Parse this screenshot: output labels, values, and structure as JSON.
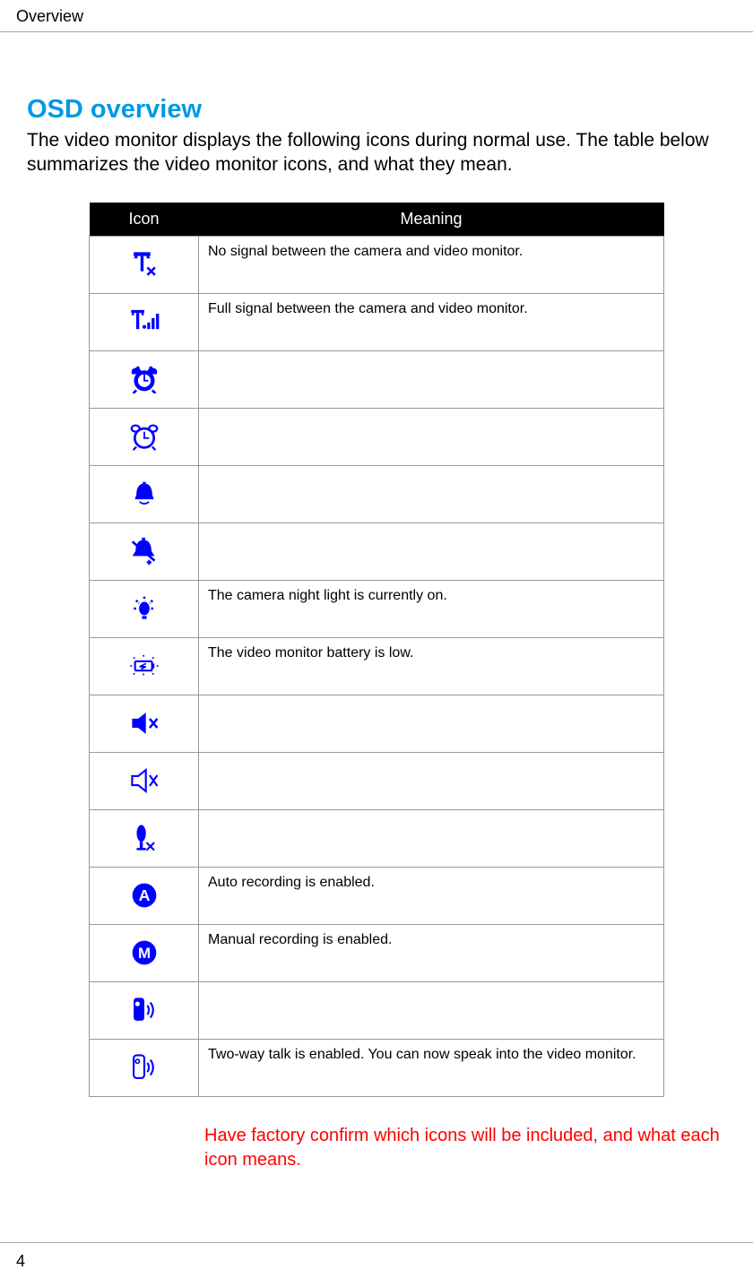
{
  "header": {
    "section": "Overview"
  },
  "title": "OSD overview",
  "intro": "The video monitor displays the following icons during normal use. The table below summarizes the video monitor icons, and what they mean.",
  "table": {
    "col_icon": "Icon",
    "col_meaning": "Meaning",
    "rows": [
      {
        "icon": "no-signal-icon",
        "meaning": "No signal between the camera and video monitor."
      },
      {
        "icon": "full-signal-icon",
        "meaning": "Full signal between the camera and video monitor."
      },
      {
        "icon": "alarm-solid-icon",
        "meaning": ""
      },
      {
        "icon": "alarm-outline-icon",
        "meaning": ""
      },
      {
        "icon": "bell-icon",
        "meaning": ""
      },
      {
        "icon": "bell-plus-icon",
        "meaning": ""
      },
      {
        "icon": "night-light-icon",
        "meaning": "The camera night light is currently on."
      },
      {
        "icon": "battery-low-icon",
        "meaning": "The video monitor battery is low."
      },
      {
        "icon": "speaker-mute-solid-icon",
        "meaning": ""
      },
      {
        "icon": "speaker-mute-outline-icon",
        "meaning": ""
      },
      {
        "icon": "mic-mute-icon",
        "meaning": ""
      },
      {
        "icon": "auto-record-icon",
        "meaning": "Auto recording is enabled."
      },
      {
        "icon": "manual-record-icon",
        "meaning": "Manual recording is enabled."
      },
      {
        "icon": "talk-solid-icon",
        "meaning": ""
      },
      {
        "icon": "talk-outline-icon",
        "meaning": "Two-way talk is enabled. You can now speak into the video monitor."
      }
    ]
  },
  "note": "Have factory confirm which icons will be included, and what each icon means.",
  "footer": {
    "page": "4"
  }
}
